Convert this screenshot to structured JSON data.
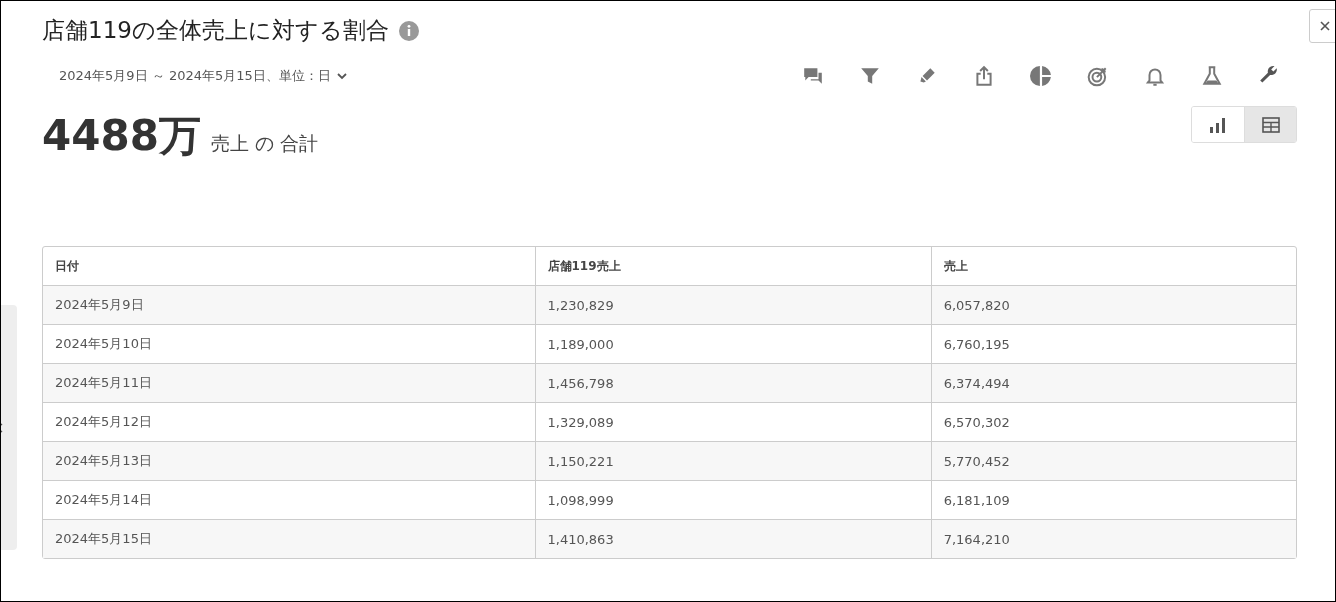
{
  "title": "店舗119の全体売上に対する割合",
  "date_range": "2024年5月9日 ～ 2024年5月15日、単位：日",
  "total": {
    "value": "4488万",
    "label": "売上 の 合計"
  },
  "view_toggle": [
    {
      "kind": "chart",
      "selected": false
    },
    {
      "kind": "table",
      "selected": true
    }
  ],
  "table": {
    "columns": [
      "日付",
      "店舗119売上",
      "売上"
    ],
    "rows": [
      [
        "2024年5月9日",
        "1,230,829",
        "6,057,820"
      ],
      [
        "2024年5月10日",
        "1,189,000",
        "6,760,195"
      ],
      [
        "2024年5月11日",
        "1,456,798",
        "6,374,494"
      ],
      [
        "2024年5月12日",
        "1,329,089",
        "6,570,302"
      ],
      [
        "2024年5月13日",
        "1,150,221",
        "5,770,452"
      ],
      [
        "2024年5月14日",
        "1,098,999",
        "6,181,109"
      ],
      [
        "2024年5月15日",
        "1,410,863",
        "7,164,210"
      ]
    ]
  }
}
